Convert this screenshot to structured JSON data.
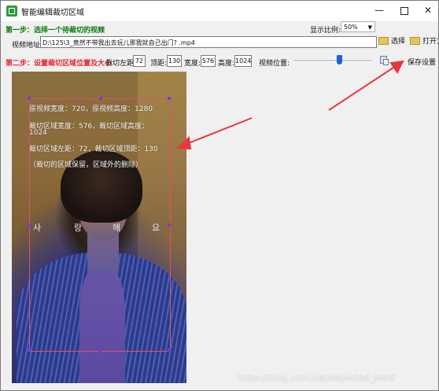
{
  "window": {
    "title": "智能编辑裁切区域",
    "minimize_glyph": "—",
    "close_glyph": "✕"
  },
  "step1": {
    "label": "第一步：选择一个待裁切的视频",
    "ratio_label": "显示比例:",
    "ratio_value": "50%",
    "address_label": "视频地址:",
    "address_value": "D:\\125\\3_竟然不带我出去玩儿那我就自己出门? .mp4",
    "browse_button": "选择",
    "open_button": "打开文"
  },
  "step2": {
    "label": "第二步：设置裁切区域位置及大小",
    "left_label": "裁切左距:",
    "left_value": "72",
    "top_label": "顶距:",
    "top_value": "130",
    "width_label": "宽度:",
    "width_value": "576",
    "height_label": "高度:",
    "height_value": "1024",
    "position_label": "视频位置:",
    "position_fraction": 0.58,
    "save_button": "保存设置"
  },
  "preview": {
    "info_line1": "原视频宽度：720，原视频高度：1280",
    "info_line2": "裁切区域宽度：576，裁切区域高度：",
    "info_line3": "1024",
    "info_line4": "裁切区域左距：72，裁切区域顶距：130",
    "info_line5": "（裁切的区域保留，区域外的删除）",
    "lyrics": [
      "사",
      "랑",
      "해",
      "요"
    ]
  },
  "annotation": {
    "arrow_color": "#e8383d"
  },
  "watermark": "https://blog.csdn.net/departed_saint"
}
